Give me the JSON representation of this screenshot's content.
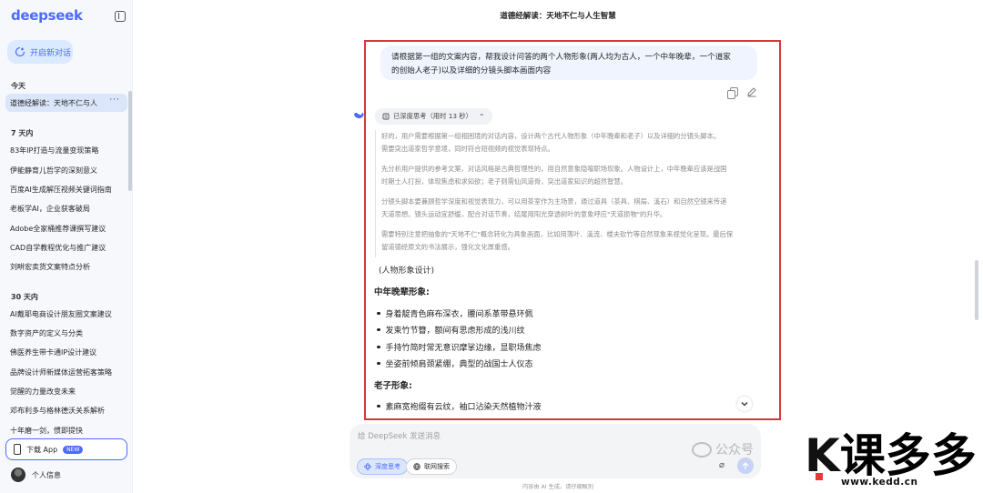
{
  "sidebar": {
    "logo": "deepseek",
    "new_chat": "开启新对话",
    "today_label": "今天",
    "today_items": [
      "道德经解读：天地不仁与人"
    ],
    "week_label": "7 天内",
    "week_items": [
      "83年IP打造与流量变现策略",
      "伊能静育儿哲学的深刻意义",
      "百度AI生成解压视频关键词指南",
      "老板学AI，企业获客破局",
      "Adobe全家桶推荐课撰写建议",
      "CAD自学教程优化与推广建议",
      "刘畊宏卖货文案特点分析"
    ],
    "month_label": "30 天内",
    "month_items": [
      "AI戴耶电商设计朋友圈文案建议",
      "数字资产的定义与分类",
      "佛医养生带卡通IP设计建议",
      "品牌设计师新媒体运营拓客策略",
      "觉醒的力量改变未来",
      "邓布利多与格林德沃关系解析",
      "十年磨一剑，惯即提快"
    ],
    "more_dots": "···",
    "download_app": "下载 App",
    "new_badge": "NEW",
    "profile": "个人信息"
  },
  "header": {
    "title": "道德经解读：天地不仁与人生智慧"
  },
  "user_message": {
    "line1": "请根据第一组的文案内容，帮我设计问答的两个人物形象(两人均为古人，一个中年晚辈，一个道家",
    "line2": "的创始人老子)以及详细的分镜头脚本画面内容"
  },
  "thinking": {
    "chip_label": "已深度思考（用时 13 秒）",
    "p1": [
      "好的，用户需要根据第一组相困境的对话内容，设计两个古代人物形象（中年晚辈和老子）以及详细的分镜头脚本。",
      "需要突出道家哲学意境，同时符合短视频的视觉表现特点。"
    ],
    "p2": [
      "先分析用户提供的参考文案，对话风格是古典哲理性的，用自然意象隐喻职场现象。人物设计上，中年晚辈应该是战国",
      "时期士人打扮，体现焦虑和求知欲；老子则需仙风道骨，突出道家知识的超然智慧。"
    ],
    "p3": [
      "分镜头脚本要兼顾哲学深度和视觉表现力，可以用茶室作为主场景，通过道具（茶具、棋局、溪石）和自然空镜来传递",
      "天道思想。镜头运动宜舒缓，配合对话节奏，结尾用阳光穿透树叶的意象呼应\"天道损物\"的升华。"
    ],
    "p4": [
      "需要特别注意把抽象的\"天地不仁\"概念转化为具象画面，比如用落叶、溪流、楼夫砍竹等自然现象来视觉化呈现。最后保",
      "留道德经原文的书法展示，强化文化厚重感。"
    ]
  },
  "answer": {
    "intro": "(人物形象设计)",
    "h1": "中年晚辈形象:",
    "h1_items": [
      "身着靛青色麻布深衣，腰间系革带悬环佩",
      "发束竹节簪，额间有思虑形成的浅川纹",
      "手持竹简时常无意识摩挲边缘，显职场焦虑",
      "坐姿前倾肩颈紧绷，典型的战国士人仪态"
    ],
    "h2": "老子形象:",
    "h2_items": [
      "素麻宽袍缀有云纹，袖口沾染天然植物汁液"
    ]
  },
  "input": {
    "placeholder": "给 DeepSeek 发送消息",
    "deep_think": "深度思考",
    "web_search": "联网搜索",
    "disclaimer": "内容由 AI 生成，请仔细甄别"
  },
  "watermark": {
    "wechat": "公众号",
    "logo_text": "课多多",
    "site": "www.kedd.cn"
  },
  "colors": {
    "accent": "#4d6bfe",
    "highlight": "#d9363e"
  }
}
